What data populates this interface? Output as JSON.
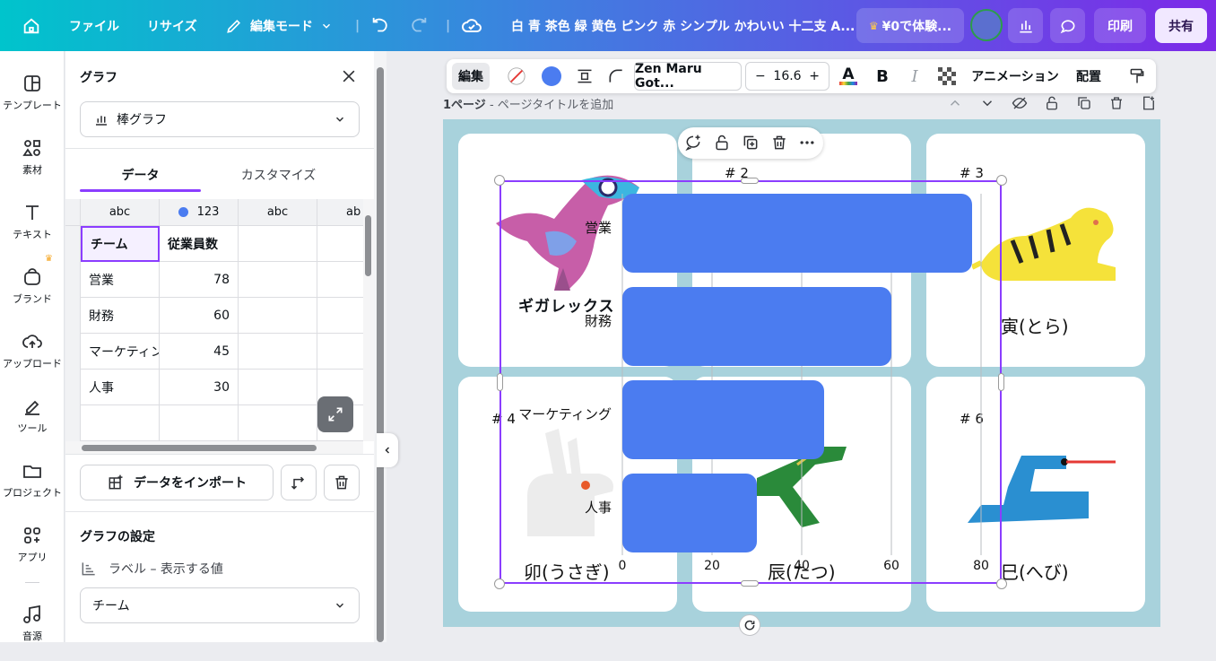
{
  "topbar": {
    "file": "ファイル",
    "resize": "リサイズ",
    "edit_mode": "編集モード",
    "doc_title": "白 青 茶色 緑 黄色 ピンク 赤 シンプル かわいい 十二支 A...",
    "trial": "¥0で体験...",
    "print": "印刷",
    "share": "共有"
  },
  "sidebar": {
    "items": [
      {
        "label": "テンプレート",
        "icon": "template-icon"
      },
      {
        "label": "素材",
        "icon": "elements-icon"
      },
      {
        "label": "テキスト",
        "icon": "text-icon"
      },
      {
        "label": "ブランド",
        "icon": "brand-icon"
      },
      {
        "label": "アップロード",
        "icon": "upload-icon"
      },
      {
        "label": "ツール",
        "icon": "tools-icon"
      },
      {
        "label": "プロジェクト",
        "icon": "folder-icon"
      },
      {
        "label": "アプリ",
        "icon": "apps-icon"
      },
      {
        "label": "音源",
        "icon": "music-icon"
      }
    ]
  },
  "panel": {
    "title": "グラフ",
    "chart_type": "棒グラフ",
    "tabs": [
      "データ",
      "カスタマイズ"
    ],
    "grid_headers": [
      "abc",
      "123",
      "abc",
      "ab"
    ],
    "rows": [
      [
        "チーム",
        "従業員数"
      ],
      [
        "営業",
        "78"
      ],
      [
        "財務",
        "60"
      ],
      [
        "マーケティング",
        "45"
      ],
      [
        "人事",
        "30"
      ]
    ],
    "import_label": "データをインポート",
    "settings_title": "グラフの設定",
    "label_setting": "ラベル – 表示する値",
    "label_value": "チーム"
  },
  "toolbar": {
    "edit": "編集",
    "font": "Zen Maru Got...",
    "size": "16.6",
    "animation": "アニメーション",
    "position": "配置"
  },
  "page_header": {
    "page": "1ページ",
    "title_placeholder": "ページタイトルを追加"
  },
  "design": {
    "card2": "# 2",
    "card3": "# 3",
    "card4": "# 4",
    "card6": "# 6",
    "gigarex": "ギガレックス",
    "tora": "寅(とら)",
    "usagi": "卯(うさぎ)",
    "tatsu": "辰(たつ)",
    "hebi": "巳(へび)"
  },
  "colors": {
    "bar": "#4b7cf0",
    "accent": "#8b3dff",
    "page_bg": "#a8d2dc"
  },
  "chart_data": {
    "type": "bar",
    "orientation": "horizontal",
    "categories": [
      "営業",
      "財務",
      "マーケティング",
      "人事"
    ],
    "values": [
      78,
      60,
      45,
      30
    ],
    "xlim": [
      0,
      85
    ],
    "xticks": [
      0,
      20,
      40,
      60,
      80
    ],
    "grid": true
  }
}
